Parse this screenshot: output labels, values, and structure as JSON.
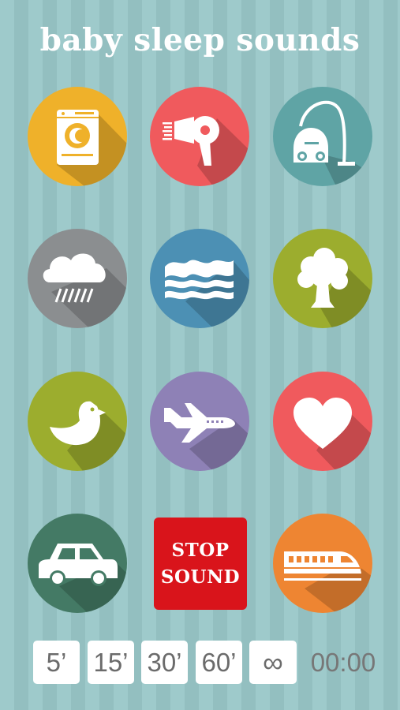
{
  "app": {
    "title": "baby sleep sounds"
  },
  "sounds": [
    {
      "name": "washing-machine",
      "color": "#efb12a"
    },
    {
      "name": "hair-dryer",
      "color": "#f05a5d"
    },
    {
      "name": "vacuum-cleaner",
      "color": "#5fa4a5"
    },
    {
      "name": "rain",
      "color": "#8b8e90"
    },
    {
      "name": "ocean-waves",
      "color": "#4c90b4"
    },
    {
      "name": "tree",
      "color": "#9cad2e"
    },
    {
      "name": "bird",
      "color": "#9cad2e"
    },
    {
      "name": "airplane",
      "color": "#8e81b6"
    },
    {
      "name": "heartbeat",
      "color": "#f05a5d"
    },
    {
      "name": "car",
      "color": "#447a65"
    },
    {
      "name": "train",
      "color": "#ee8532"
    }
  ],
  "stop_button": {
    "line1": "STOP",
    "line2": "SOUND",
    "color": "#d9141b"
  },
  "timers": [
    "5’",
    "15’",
    "30’",
    "60’",
    "∞"
  ],
  "clock": "00:00"
}
